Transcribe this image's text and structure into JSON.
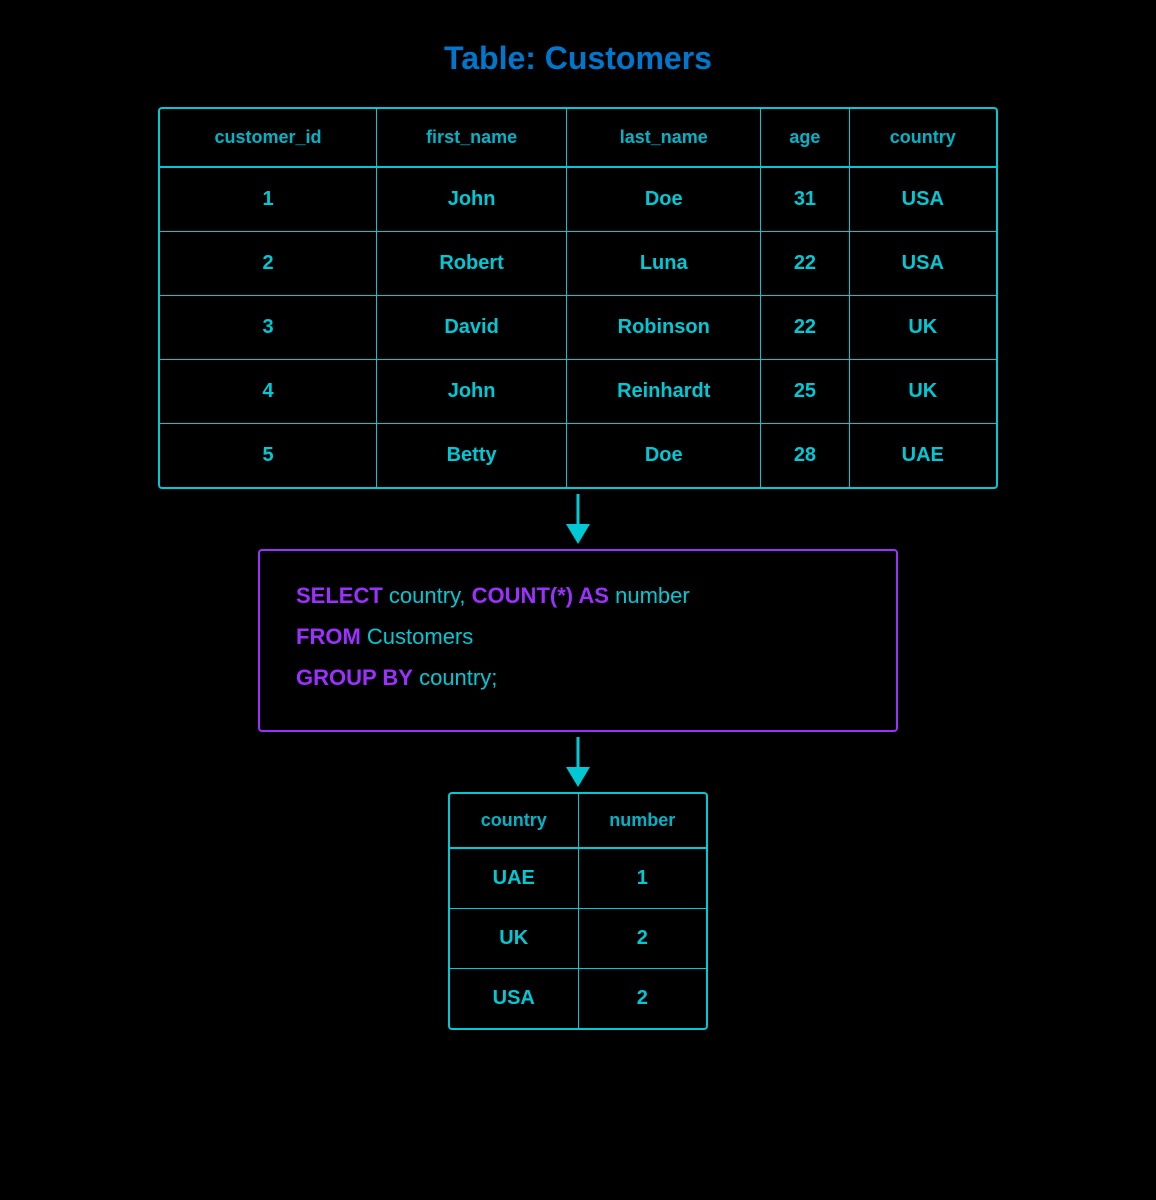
{
  "page": {
    "title": "Table: Customers",
    "background": "#000000"
  },
  "customers_table": {
    "headers": [
      "customer_id",
      "first_name",
      "last_name",
      "age",
      "country"
    ],
    "rows": [
      {
        "customer_id": "1",
        "first_name": "John",
        "last_name": "Doe",
        "age": "31",
        "country": "USA"
      },
      {
        "customer_id": "2",
        "first_name": "Robert",
        "last_name": "Luna",
        "age": "22",
        "country": "USA"
      },
      {
        "customer_id": "3",
        "first_name": "David",
        "last_name": "Robinson",
        "age": "22",
        "country": "UK"
      },
      {
        "customer_id": "4",
        "first_name": "John",
        "last_name": "Reinhardt",
        "age": "25",
        "country": "UK"
      },
      {
        "customer_id": "5",
        "first_name": "Betty",
        "last_name": "Doe",
        "age": "28",
        "country": "UAE"
      }
    ]
  },
  "sql_query": {
    "line1_keyword": "SELECT",
    "line1_text": " country, ",
    "line1_bold_keyword": "COUNT(*) AS",
    "line1_end": " number",
    "line2_keyword": "FROM",
    "line2_text": " Customers",
    "line3_keyword": "GROUP BY",
    "line3_text": " country;"
  },
  "result_table": {
    "headers": [
      "country",
      "number"
    ],
    "rows": [
      {
        "country": "UAE",
        "number": "1"
      },
      {
        "country": "UK",
        "number": "2"
      },
      {
        "country": "USA",
        "number": "2"
      }
    ]
  }
}
